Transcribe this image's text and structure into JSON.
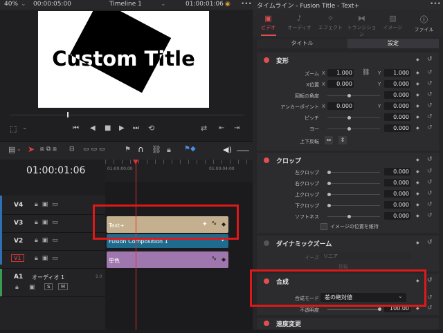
{
  "viewer": {
    "zoom": "40%",
    "duration": "00:00:05:00",
    "timeline_name": "Timeline 1",
    "timecode": "01:00:01:06",
    "canvas_text": "Custom Title"
  },
  "timeline": {
    "current_timecode": "01:00:01:06",
    "ruler_labels": [
      "01:00:00:00",
      "01:00:04:00"
    ],
    "tracks": [
      {
        "name": "V4"
      },
      {
        "name": "V3"
      },
      {
        "name": "V2"
      },
      {
        "name": "V1"
      }
    ],
    "audio_track": {
      "name": "A1",
      "label": "オーディオ 1",
      "channels": "2.0",
      "solo": "S",
      "mute": "M"
    },
    "clips": {
      "text_plus": "Text+",
      "fusion": "Fusion Composition 1",
      "solid": "単色"
    }
  },
  "inspector": {
    "title": "タイムライン - Fusion Title - Text+",
    "tabs": [
      "ビデオ",
      "オーディオ",
      "エフェクト",
      "トランジション",
      "イメージ",
      "ファイル"
    ],
    "subtabs": [
      "タイトル",
      "設定"
    ],
    "transform": {
      "title": "変形",
      "zoom_label": "ズーム",
      "zoom_x": "1.000",
      "zoom_y": "1.000",
      "position_label": "X位置",
      "position_x": "0.000",
      "position_y": "0.000",
      "rotation_label": "回転の角度",
      "rotation": "0.000",
      "anchor_label": "アンカーポイント",
      "anchor_x": "0.000",
      "anchor_y": "0.000",
      "pitch_label": "ピッチ",
      "pitch": "0.000",
      "yaw_label": "ヨー",
      "yaw": "0.000",
      "flip_label": "上下反転"
    },
    "crop": {
      "title": "クロップ",
      "left_label": "左クロップ",
      "left": "0.000",
      "right_label": "右クロップ",
      "right": "0.000",
      "top_label": "上クロップ",
      "top": "0.000",
      "bottom_label": "下クロップ",
      "bottom": "0.000",
      "soft_label": "ソフトネス",
      "soft": "0.000",
      "retain_label": "イメージの位置を維持"
    },
    "dynamic_zoom": {
      "title": "ダイナミックズーム",
      "ease_label": "イーズ",
      "ease_value": "リニア",
      "swap_label": "反転"
    },
    "composite": {
      "title": "合成",
      "mode_label": "合成モード",
      "mode_value": "差の絶対値",
      "opacity_label": "不透明度",
      "opacity": "100.00"
    },
    "speed": {
      "title": "速度変更"
    }
  }
}
